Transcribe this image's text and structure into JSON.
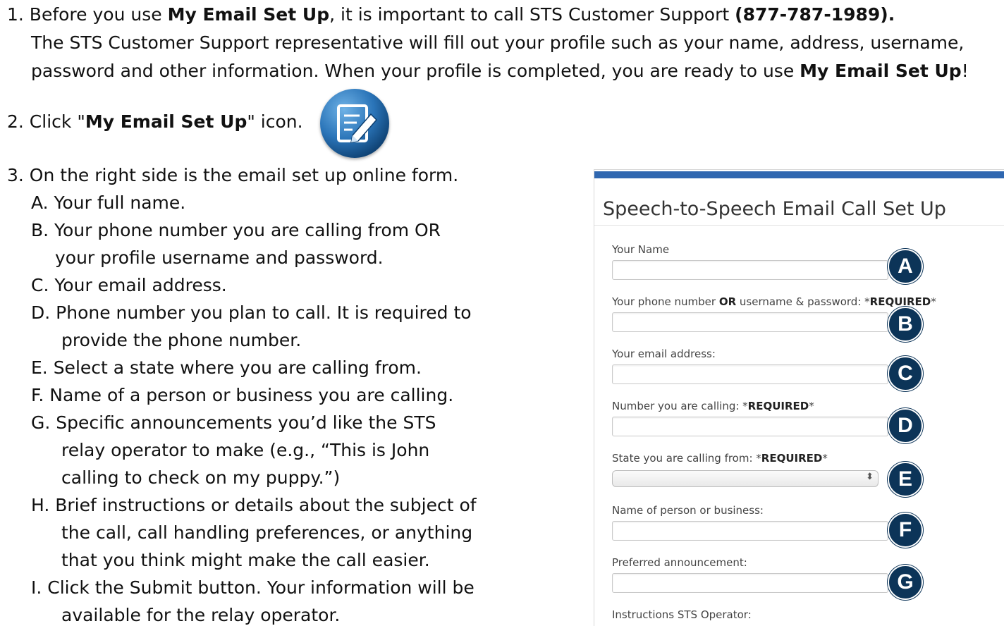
{
  "instructions": {
    "step1": {
      "line1_a": "1. Before you use ",
      "line1_b": "My Email Set Up",
      "line1_c": ", it is important to call STS Customer Support ",
      "line1_d": "(877-787-1989).",
      "line2": "The STS Customer Support representative will fill out your profile such as your name, address, username,",
      "line3_a": "password and other information. When your profile is completed, you are ready to use ",
      "line3_b": "My Email Set Up",
      "line3_c": "!"
    },
    "step2": {
      "a": "2. Click \"",
      "b": "My Email Set Up",
      "c": "\" icon.",
      "icon": "email-setup-icon"
    },
    "step3": {
      "intro": "3. On the right side is the email set up online form.",
      "lines": [
        "A. Your full name.",
        "B. Your phone number you are calling from OR",
        "your profile username and password.",
        "C. Your email address.",
        "D. Phone number you plan to call. It is required to",
        "provide the phone number.",
        "E. Select a state where you are calling from.",
        "F.  Name of a person or business you are calling.",
        "G. Specific announcements you’d like the STS",
        "relay operator to make (e.g., “This is John",
        "calling to check on my puppy.”)",
        "H. Brief instructions or details about the subject of",
        "the call, call handling preferences, or anything",
        "that you think might make the call easier.",
        "I.  Click the Submit button. Your information will be",
        "available for the relay operator."
      ]
    }
  },
  "form": {
    "title": "Speech-to-Speech Email Call Set Up",
    "accent_color": "#2f67b0",
    "badge_color": "#0c3458",
    "fields": {
      "name": {
        "label": "Your Name",
        "badge": "A"
      },
      "phone": {
        "label_a": "Your phone number ",
        "label_b": "OR",
        "label_c": " username & password: *",
        "label_d": "REQUIRED",
        "label_e": "*",
        "badge": "B"
      },
      "email": {
        "label": "Your email address:",
        "badge": "C"
      },
      "calling": {
        "label_a": "Number you are calling: *",
        "label_b": "REQUIRED",
        "label_c": "*",
        "badge": "D"
      },
      "state": {
        "label_a": "State you are calling from: *",
        "label_b": "REQUIRED",
        "label_c": "*",
        "badge": "E",
        "arrow": "⬍"
      },
      "person": {
        "label": "Name of person or business:",
        "badge": "F"
      },
      "announcement": {
        "label": "Preferred announcement:",
        "badge": "G"
      },
      "instructions": {
        "label": "Instructions STS Operator:"
      }
    }
  }
}
